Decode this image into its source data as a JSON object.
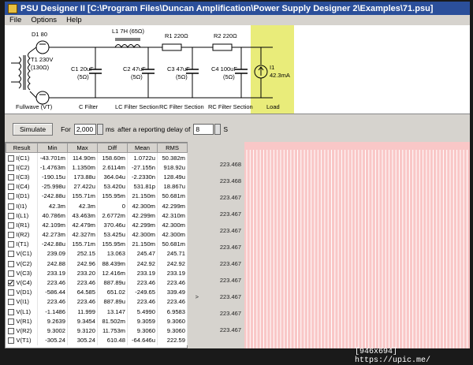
{
  "window": {
    "title": "PSU Designer II  [C:\\Program Files\\Duncan Amplification\\Power Supply Designer 2\\Examples\\71.psu]"
  },
  "menu": [
    "File",
    "Options",
    "Help"
  ],
  "schematic": {
    "rectifier": {
      "diode": "D1 80",
      "transformer": "T1 230V",
      "resistance": "(130Ω)",
      "caption": "Fullwave (VT)"
    },
    "c1": {
      "value": "C1 20uF",
      "esr": "(5Ω)",
      "caption": "C Filter"
    },
    "l1": {
      "label": "L1 7H (65Ω)"
    },
    "c2": {
      "value": "C2 47uF",
      "esr": "(5Ω)",
      "caption": "LC Filter Section"
    },
    "r1": {
      "label": "R1 220Ω"
    },
    "c3": {
      "value": "C3 47uF",
      "esr": "(5Ω)",
      "caption": "RC Filter Section"
    },
    "r2": {
      "label": "R2 220Ω"
    },
    "c4": {
      "value": "C4 100uF",
      "esr": "(5Ω)",
      "caption": "RC Filter Section"
    },
    "load": {
      "name": "I1",
      "value": "42.3mA",
      "caption": "Load",
      "highlight": "#e9ec7a"
    }
  },
  "simulation": {
    "button": "Simulate",
    "for_label": "For",
    "duration": "2,000",
    "duration_unit": "ms",
    "delay_label": "after a reporting delay of",
    "delay": "8",
    "delay_unit": "S"
  },
  "results": {
    "columns": [
      "Result",
      "Min",
      "Max",
      "Diff",
      "Mean",
      "RMS"
    ],
    "rows": [
      {
        "name": "I(C1)",
        "checked": false,
        "min": "-43.701m",
        "max": "114.90m",
        "diff": "158.60m",
        "mean": "1.0722u",
        "rms": "50.382m"
      },
      {
        "name": "I(C2)",
        "checked": false,
        "min": "-1.4763m",
        "max": "1.1350m",
        "diff": "2.6114m",
        "mean": "-27.155n",
        "rms": "918.92u"
      },
      {
        "name": "I(C3)",
        "checked": false,
        "min": "-190.15u",
        "max": "173.88u",
        "diff": "364.04u",
        "mean": "-2.2330n",
        "rms": "128.49u"
      },
      {
        "name": "I(C4)",
        "checked": false,
        "min": "-25.998u",
        "max": "27.422u",
        "diff": "53.420u",
        "mean": "531.81p",
        "rms": "18.867u"
      },
      {
        "name": "I(D1)",
        "checked": false,
        "min": "-242.88u",
        "max": "155.71m",
        "diff": "155.95m",
        "mean": "21.150m",
        "rms": "50.681m"
      },
      {
        "name": "I(I1)",
        "checked": false,
        "min": "42.3m",
        "max": "42.3m",
        "diff": "0",
        "mean": "42.300m",
        "rms": "42.299m"
      },
      {
        "name": "I(L1)",
        "checked": false,
        "min": "40.786m",
        "max": "43.463m",
        "diff": "2.6772m",
        "mean": "42.299m",
        "rms": "42.310m"
      },
      {
        "name": "I(R1)",
        "checked": false,
        "min": "42.109m",
        "max": "42.479m",
        "diff": "370.46u",
        "mean": "42.299m",
        "rms": "42.300m"
      },
      {
        "name": "I(R2)",
        "checked": false,
        "min": "42.273m",
        "max": "42.327m",
        "diff": "53.425u",
        "mean": "42.300m",
        "rms": "42.300m"
      },
      {
        "name": "I(T1)",
        "checked": false,
        "min": "-242.88u",
        "max": "155.71m",
        "diff": "155.95m",
        "mean": "21.150m",
        "rms": "50.681m"
      },
      {
        "name": "V(C1)",
        "checked": false,
        "min": "239.09",
        "max": "252.15",
        "diff": "13.063",
        "mean": "245.47",
        "rms": "245.71"
      },
      {
        "name": "V(C2)",
        "checked": false,
        "min": "242.88",
        "max": "242.96",
        "diff": "88.439m",
        "mean": "242.92",
        "rms": "242.92"
      },
      {
        "name": "V(C3)",
        "checked": false,
        "min": "233.19",
        "max": "233.20",
        "diff": "12.416m",
        "mean": "233.19",
        "rms": "233.19"
      },
      {
        "name": "V(C4)",
        "checked": true,
        "min": "223.46",
        "max": "223.46",
        "diff": "887.89u",
        "mean": "223.46",
        "rms": "223.46"
      },
      {
        "name": "V(D1)",
        "checked": false,
        "min": "-586.44",
        "max": "64.585",
        "diff": "651.02",
        "mean": "-249.65",
        "rms": "339.49"
      },
      {
        "name": "V(I1)",
        "checked": false,
        "min": "223.46",
        "max": "223.46",
        "diff": "887.89u",
        "mean": "223.46",
        "rms": "223.46"
      },
      {
        "name": "V(L1)",
        "checked": false,
        "min": "-1.1486",
        "max": "11.999",
        "diff": "13.147",
        "mean": "5.4990",
        "rms": "6.9583"
      },
      {
        "name": "V(R1)",
        "checked": false,
        "min": "9.2639",
        "max": "9.3454",
        "diff": "81.502m",
        "mean": "9.3059",
        "rms": "9.3060"
      },
      {
        "name": "V(R2)",
        "checked": false,
        "min": "9.3002",
        "max": "9.3120",
        "diff": "11.753m",
        "mean": "9.3060",
        "rms": "9.3060"
      },
      {
        "name": "V(T1)",
        "checked": false,
        "min": "-305.24",
        "max": "305.24",
        "diff": "610.48",
        "mean": "-64.646u",
        "rms": "222.59"
      }
    ]
  },
  "graph": {
    "y_ticks": [
      "223.468",
      "223.468",
      "223.467",
      "223.467",
      "223.467",
      "223.467",
      "223.467",
      "223.467",
      "223.467",
      "223.467",
      "223.467"
    ],
    "cursor_marker": ">",
    "background": "#f9c7c7",
    "trace_color": "#ffffff"
  },
  "footer": {
    "stamp": "[946x694] https://upic.me/"
  }
}
